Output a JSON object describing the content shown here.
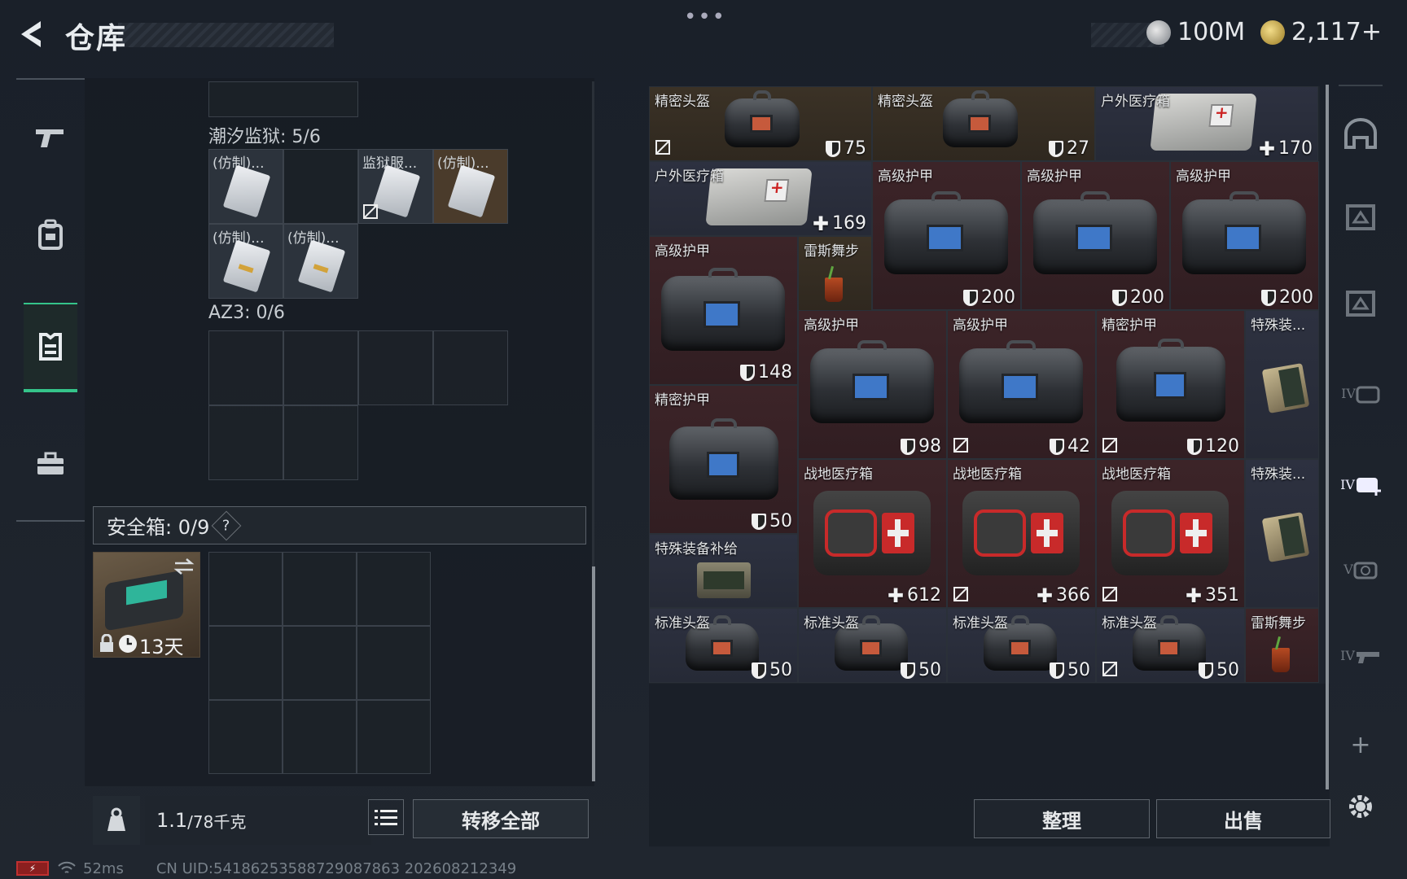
{
  "header": {
    "title": "仓库",
    "menu_dots": "•••",
    "currencies": [
      {
        "icon": "silver-coin-icon",
        "value": "100M"
      },
      {
        "icon": "gold-coin-icon",
        "value": "2,117+"
      }
    ]
  },
  "left_nav": {
    "items": [
      {
        "icon": "pistol-icon"
      },
      {
        "icon": "backpack-icon"
      },
      {
        "icon": "armor-vest-icon",
        "active": true
      },
      {
        "icon": "briefcase-icon"
      }
    ]
  },
  "containers": [
    {
      "label": "潮汐监狱: 5/6",
      "items": [
        {
          "name": "(仿制)..."
        },
        {
          "name": "监狱服..."
        },
        {
          "name": "(仿制)..."
        },
        {
          "name": "(仿制)..."
        },
        {
          "name": "(仿制)..."
        }
      ]
    },
    {
      "label": "AZ3: 0/6",
      "items": []
    }
  ],
  "safebox": {
    "label": "安全箱: 0/9",
    "help": "?",
    "item_timer": "13天"
  },
  "footer_left": {
    "weight_current": "1.1",
    "weight_max": "/78千克",
    "transfer_all": "转移全部"
  },
  "stash": {
    "items": [
      {
        "name": "精密头盔",
        "value": "75",
        "kind": "durability"
      },
      {
        "name": "精密头盔",
        "value": "27",
        "kind": "durability"
      },
      {
        "name": "户外医疗箱",
        "value": "170",
        "kind": "heal"
      },
      {
        "name": "户外医疗箱",
        "value": "169",
        "kind": "heal"
      },
      {
        "name": "高级护甲",
        "value": "200",
        "kind": "durability"
      },
      {
        "name": "高级护甲",
        "value": "200",
        "kind": "durability"
      },
      {
        "name": "高级护甲",
        "value": "200",
        "kind": "durability"
      },
      {
        "name": "高级护甲",
        "value": "148",
        "kind": "durability"
      },
      {
        "name": "雷斯舞步",
        "value": "",
        "kind": "none"
      },
      {
        "name": "高级护甲",
        "value": "98",
        "kind": "durability"
      },
      {
        "name": "高级护甲",
        "value": "42",
        "kind": "durability"
      },
      {
        "name": "精密护甲",
        "value": "120",
        "kind": "durability"
      },
      {
        "name": "特殊装...",
        "value": "",
        "kind": "none"
      },
      {
        "name": "精密护甲",
        "value": "50",
        "kind": "durability"
      },
      {
        "name": "战地医疗箱",
        "value": "612",
        "kind": "heal"
      },
      {
        "name": "战地医疗箱",
        "value": "366",
        "kind": "heal"
      },
      {
        "name": "战地医疗箱",
        "value": "351",
        "kind": "heal"
      },
      {
        "name": "特殊装...",
        "value": "",
        "kind": "none"
      },
      {
        "name": "特殊装备补给",
        "value": "",
        "kind": "none"
      },
      {
        "name": "标准头盔",
        "value": "50",
        "kind": "durability"
      },
      {
        "name": "标准头盔",
        "value": "50",
        "kind": "durability"
      },
      {
        "name": "标准头盔",
        "value": "50",
        "kind": "durability"
      },
      {
        "name": "标准头盔",
        "value": "50",
        "kind": "durability"
      },
      {
        "name": "雷斯舞步",
        "value": "",
        "kind": "none"
      }
    ]
  },
  "footer_right": {
    "sort": "整理",
    "sell": "出售"
  },
  "right_nav": {
    "items": [
      {
        "icon": "helmet-icon"
      },
      {
        "icon": "armor-tier-icon"
      },
      {
        "icon": "armor-tier-icon"
      },
      {
        "icon": "medkit-tier-iv-icon",
        "text": "IV"
      },
      {
        "icon": "medkit-tier-iv-add-icon",
        "text": "IV"
      },
      {
        "icon": "medkit-tier-v-icon",
        "text": "V"
      },
      {
        "icon": "rifle-tier-iv-icon",
        "text": "IV"
      },
      {
        "icon": "plus-icon",
        "text": "+"
      },
      {
        "icon": "gear-icon"
      }
    ]
  },
  "status": {
    "ping": "52ms",
    "uid": "CN UID:541862535887290878​63 202608212349"
  },
  "colors": {
    "accent_green": "#35c48a",
    "cell_brown": "#3b3226",
    "cell_red": "#3c2428",
    "cell_blue": "#2d3140"
  }
}
